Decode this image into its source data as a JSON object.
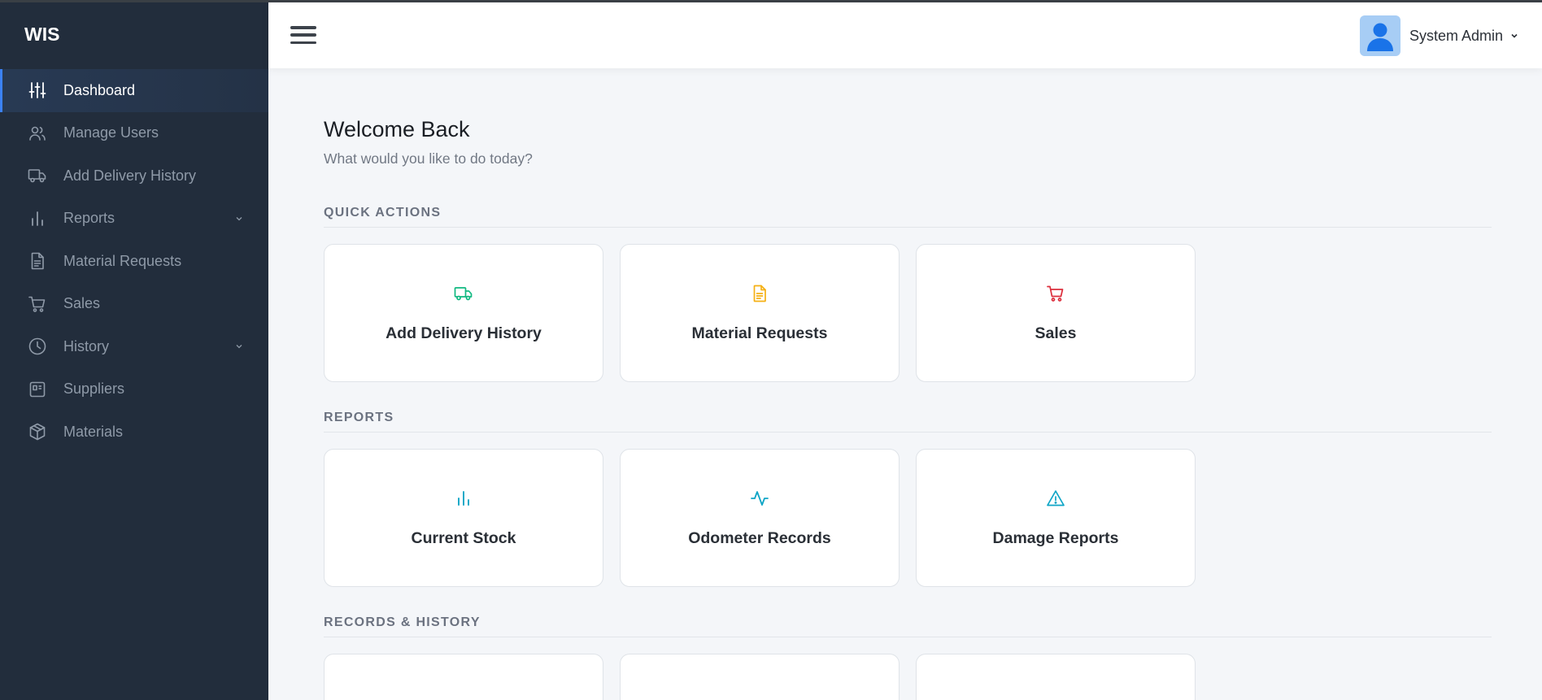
{
  "brand": "WIS",
  "sidebar": {
    "items": [
      {
        "label": "Dashboard",
        "icon": "sliders-icon",
        "active": true
      },
      {
        "label": "Manage Users",
        "icon": "users-icon"
      },
      {
        "label": "Add Delivery History",
        "icon": "truck-icon"
      },
      {
        "label": "Reports",
        "icon": "bar-chart-icon",
        "has_submenu": true
      },
      {
        "label": "Material Requests",
        "icon": "document-icon"
      },
      {
        "label": "Sales",
        "icon": "cart-icon"
      },
      {
        "label": "History",
        "icon": "clock-icon",
        "has_submenu": true
      },
      {
        "label": "Suppliers",
        "icon": "id-card-icon"
      },
      {
        "label": "Materials",
        "icon": "box-icon"
      }
    ]
  },
  "header": {
    "user_name": "System Admin"
  },
  "main": {
    "welcome": "Welcome Back",
    "subtitle": "What would you like to do today?",
    "sections": [
      {
        "title": "QUICK ACTIONS",
        "cards": [
          {
            "label": "Add Delivery History",
            "icon": "truck-icon",
            "color": "#10b981"
          },
          {
            "label": "Material Requests",
            "icon": "document-icon",
            "color": "#f5b014"
          },
          {
            "label": "Sales",
            "icon": "cart-icon",
            "color": "#dc2e3c"
          }
        ]
      },
      {
        "title": "REPORTS",
        "cards": [
          {
            "label": "Current Stock",
            "icon": "bar-chart-icon",
            "color": "#0ea5c6"
          },
          {
            "label": "Odometer Records",
            "icon": "activity-icon",
            "color": "#0ea5c6"
          },
          {
            "label": "Damage Reports",
            "icon": "warning-icon",
            "color": "#0ea5c6"
          }
        ]
      },
      {
        "title": "RECORDS & HISTORY"
      }
    ]
  },
  "colors": {
    "sidebar_bg": "#222d3c",
    "active_accent": "#3b82f6",
    "page_bg": "#f4f6f9"
  }
}
